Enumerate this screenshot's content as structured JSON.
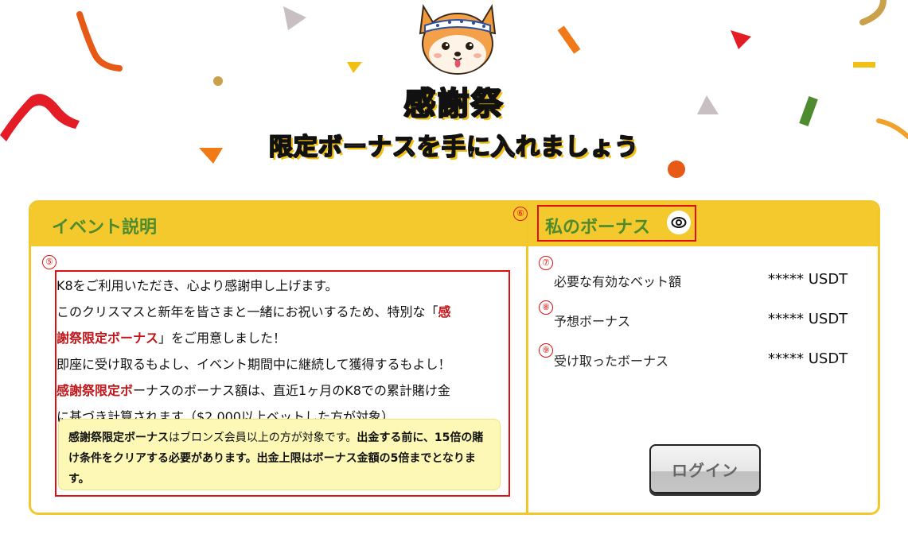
{
  "header": {
    "title": "感謝祭",
    "subtitle": "限定ボーナスを手に入れましょう"
  },
  "event": {
    "title": "イベント説明",
    "marker": "⑤",
    "lines": [
      "K8をご利用いただき、心より感謝申し上げます。",
      "このクリスマスと新年を皆さまと一緒にお祝いするため、特別な「",
      "感",
      "謝祭限定ボーナス",
      "」をご用意しました！",
      "即座に受け取るもよし、イベント期間中に継続して獲得するもよし！",
      "感謝祭限定ボ",
      "ーナスのボーナス額は、直近1ヶ月のK8での累計賭け金",
      "に基づき計算されます（$2,000以上ベットした方が対象）"
    ],
    "note": {
      "part1": "感謝祭限定ボーナス",
      "part2": "はブロンズ会員以上の方が対象です。",
      "part3": "出金する前に、",
      "part4": "15倍の賭け条件をクリアする必要があります。出金上限はボーナス金額の5倍までとなります。"
    }
  },
  "bonus": {
    "title": "私のボーナス",
    "marker": "⑥",
    "eye_icon": "eye-icon",
    "rows": [
      {
        "marker": "⑦",
        "label": "必要な有効なベット額",
        "value": "***** USDT"
      },
      {
        "marker": "⑧",
        "label": "予想ボーナス",
        "value": "***** USDT"
      },
      {
        "marker": "⑨",
        "label": "受け取ったボーナス",
        "value": "***** USDT"
      }
    ],
    "login_label": "ログイン"
  },
  "colors": {
    "header_yellow": "#f3c92d",
    "title_green": "#4e8a2e",
    "highlight_red": "#c0161a",
    "note_bg": "#fdf8b5",
    "marker_red": "#e01010"
  }
}
